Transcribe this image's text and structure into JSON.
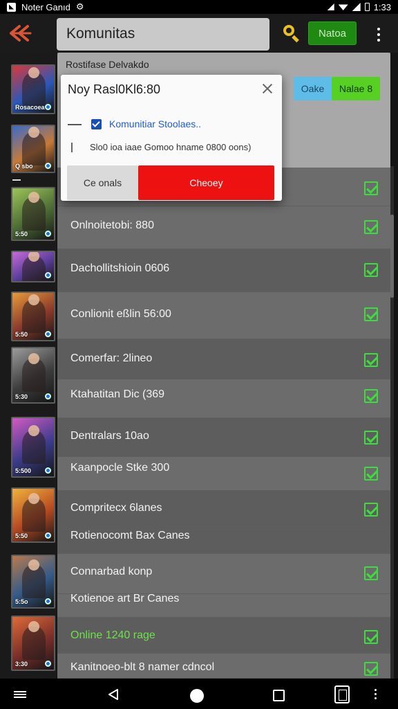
{
  "status_bar": {
    "app_name": "Noter Ganıd",
    "time": "1:33"
  },
  "app_bar": {
    "search_value": "Komunitas",
    "action_button": "Natoa"
  },
  "panel": {
    "title": "Rostifase Delvakdo",
    "buttons": {
      "blue": "Oake",
      "green": "Nalae 8"
    }
  },
  "dialog": {
    "title": "Noy Rasl0Kl6:80",
    "option_label": "Komunitiar Stoolaes..",
    "info_line": "Slo0 ioa iaae  Gomoo hname 0800 oons)",
    "cancel_label": "Ce onals",
    "confirm_label": "Cheoey"
  },
  "thumbnails": [
    {
      "caption": "Rosacoea",
      "bg": "#2c58b8",
      "accent": "#d9383a"
    },
    {
      "caption": "Q sbo",
      "bg": "#c77a38",
      "accent": "#3a6cc8"
    },
    {
      "caption": "5:50",
      "bg": "#4d6d35",
      "accent": "#9cc45a"
    },
    {
      "caption": "",
      "bg": "#5a3e99",
      "accent": "#c76bd9"
    },
    {
      "caption": "5:50",
      "bg": "#8a3a2a",
      "accent": "#e89a3a"
    },
    {
      "caption": "5:30",
      "bg": "#3d3d3d",
      "accent": "#9c9c9c"
    },
    {
      "caption": "5:500",
      "bg": "#3a3c8a",
      "accent": "#d35ac4"
    },
    {
      "caption": "5:50",
      "bg": "#b54a22",
      "accent": "#f1b23d"
    },
    {
      "caption": "5:5o",
      "bg": "#345b88",
      "accent": "#b97a4c"
    },
    {
      "caption": "3:30",
      "bg": "#7a2f2a",
      "accent": "#e06a38"
    }
  ],
  "rows": [
    {
      "label": "",
      "checked": true,
      "highlight": false
    },
    {
      "label": "Onlnoitetobi: 880",
      "checked": true,
      "highlight": false
    },
    {
      "label": "Dachollitshioin 0606",
      "checked": true,
      "highlight": false
    },
    {
      "label": "Conlionit eßlin 56:00",
      "checked": true,
      "highlight": false
    },
    {
      "label": "Comerfar: 2lineo",
      "checked": true,
      "highlight": false
    },
    {
      "label": "Ktahatitan Dic (369",
      "checked": true,
      "highlight": false
    },
    {
      "label": "Dentralars 10ao",
      "checked": true,
      "highlight": false
    },
    {
      "label": "Kaanpocle Stke 300",
      "checked": true,
      "highlight": false
    },
    {
      "label": "Compritecx 6lanes",
      "checked": true,
      "highlight": false
    },
    {
      "label": "Rotienocomt Bax Canes",
      "checked": false,
      "highlight": false
    },
    {
      "label": "Connarbad konp",
      "checked": true,
      "highlight": false
    },
    {
      "label": "Kotienoe art Br Canes",
      "checked": false,
      "highlight": false
    },
    {
      "label": "Online 1240 rage",
      "checked": true,
      "highlight": true
    },
    {
      "label": "Kanitnoeo-blt 8 namer cdncol",
      "checked": true,
      "highlight": false
    }
  ]
}
